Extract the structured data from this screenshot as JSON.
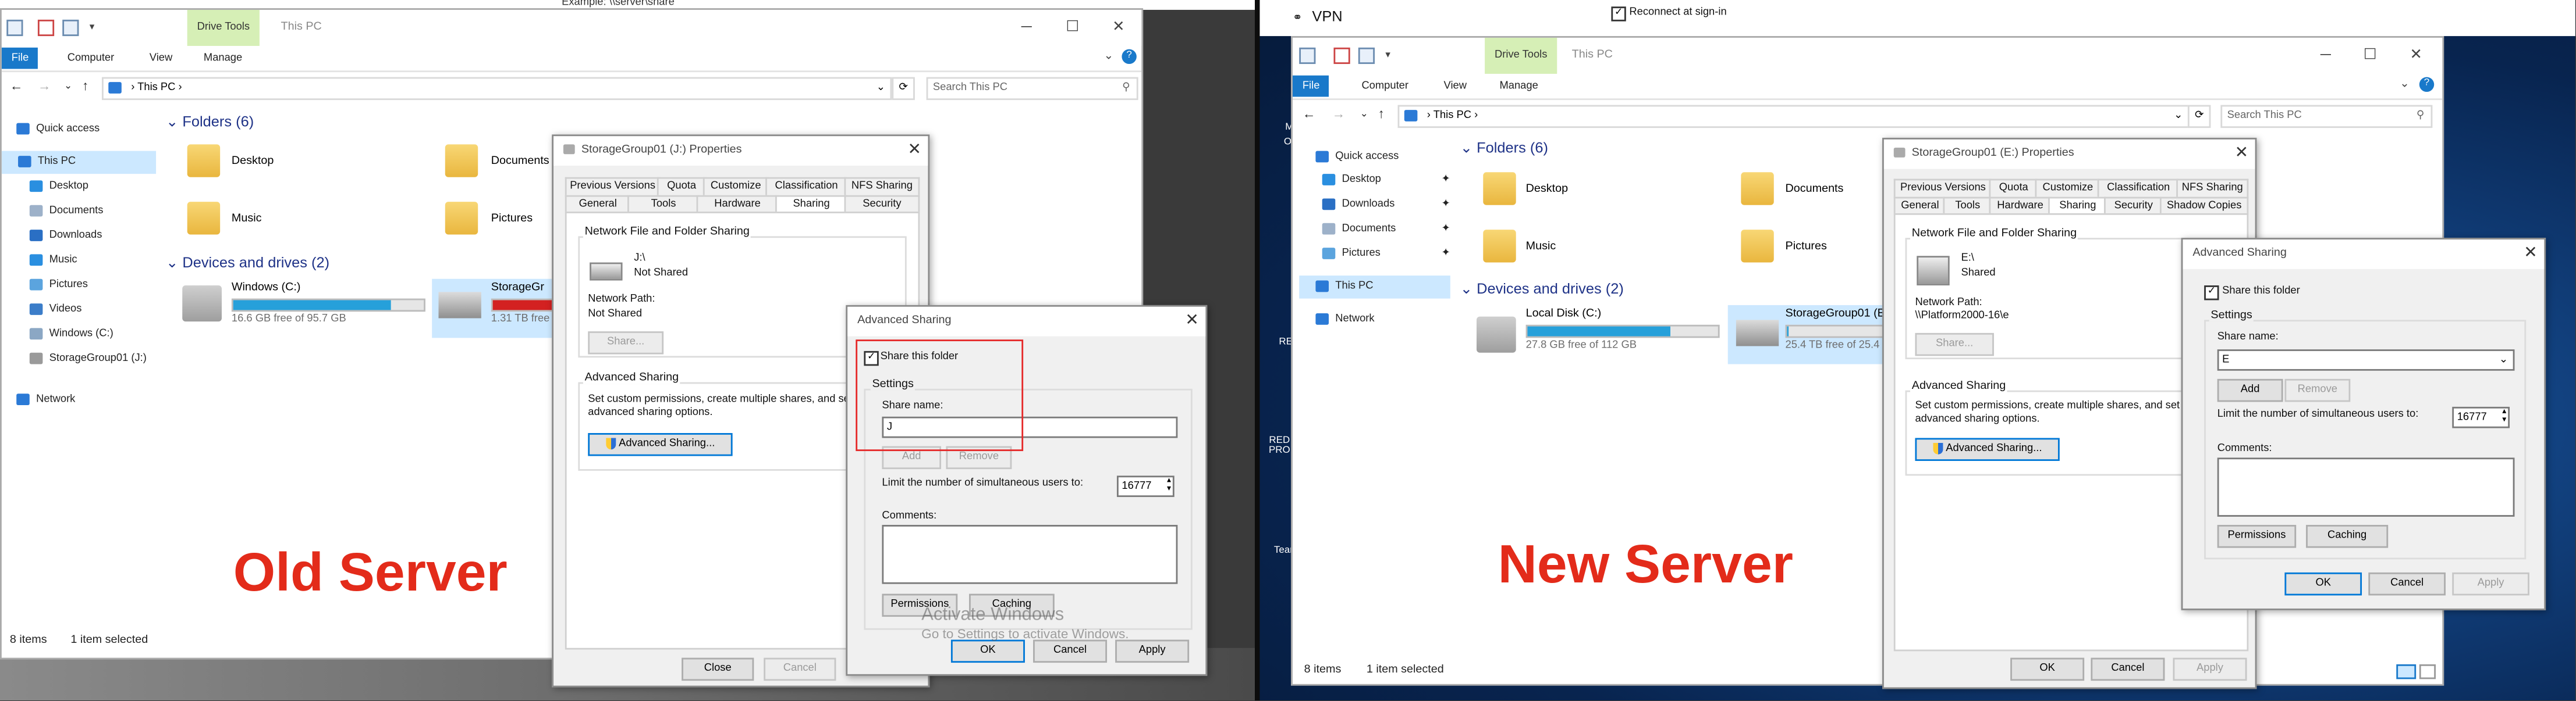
{
  "labels": {
    "left": "Old Server",
    "right": "New Server"
  },
  "watermark": {
    "line1": "Activate Windows",
    "line2": "Go to Settings to activate Windows."
  },
  "left": {
    "top_hint": "Example: \\\\server\\share",
    "ribbon": {
      "context_tab": "Drive Tools",
      "title": "This PC",
      "tabs": [
        "File",
        "Computer",
        "View",
        "Manage"
      ]
    },
    "address": {
      "path": "This PC",
      "search_placeholder": "Search This PC"
    },
    "nav": {
      "quick_access": "Quick access",
      "this_pc": "This PC",
      "items": [
        "Desktop",
        "Documents",
        "Downloads",
        "Music",
        "Pictures",
        "Videos",
        "Windows (C:)",
        "StorageGroup01 (J:)"
      ],
      "network": "Network"
    },
    "folders": {
      "header": "Folders (6)",
      "items": [
        "Desktop",
        "Documents",
        "Music",
        "Pictures"
      ]
    },
    "drives": {
      "header": "Devices and drives (2)",
      "items": [
        {
          "name": "Windows (C:)",
          "free": "16.6 GB free of 95.7 GB",
          "used_fraction": 0.83
        },
        {
          "name": "StorageGr",
          "free": "1.31 TB free",
          "used_fraction": 0.9
        }
      ]
    },
    "status": {
      "count": "8 items",
      "selected": "1 item selected"
    },
    "props": {
      "title": "StorageGroup01 (J:) Properties",
      "tabs_top": [
        "Previous Versions",
        "Quota",
        "Customize",
        "Classification",
        "NFS Sharing"
      ],
      "tabs_bottom": [
        "General",
        "Tools",
        "Hardware",
        "Sharing",
        "Security"
      ],
      "nfs_group": "Network File and Folder Sharing",
      "drive_path": "J:\\",
      "drive_state": "Not Shared",
      "network_path_label": "Network Path:",
      "network_path": "Not Shared",
      "share_btn": "Share...",
      "adv_group": "Advanced Sharing",
      "adv_desc": "Set custom permissions, create multiple shares, and set advanced sharing options.",
      "adv_btn": "Advanced Sharing...",
      "close": "Close",
      "cancel": "Cancel"
    },
    "adv": {
      "title": "Advanced Sharing",
      "share_check": "Share this folder",
      "settings": "Settings",
      "share_name_label": "Share name:",
      "share_name": "J",
      "add": "Add",
      "remove": "Remove",
      "limit_label": "Limit the number of simultaneous users to:",
      "limit": "16777",
      "comments": "Comments:",
      "permissions": "Permissions",
      "caching": "Caching",
      "ok": "OK",
      "cancel": "Cancel",
      "apply": "Apply"
    }
  },
  "right": {
    "vpn": "VPN",
    "reconnect": "Reconnect at sign-in",
    "desktop_icons": [
      "M",
      "Or",
      "RED",
      "RED PRO",
      "Team"
    ],
    "ribbon": {
      "context_tab": "Drive Tools",
      "title": "This PC",
      "tabs": [
        "File",
        "Computer",
        "View",
        "Manage"
      ]
    },
    "address": {
      "path": "This PC",
      "search_placeholder": "Search This PC"
    },
    "nav": {
      "quick_access": "Quick access",
      "items": [
        "Desktop",
        "Downloads",
        "Documents",
        "Pictures"
      ],
      "this_pc": "This PC",
      "network": "Network"
    },
    "folders": {
      "header": "Folders (6)",
      "items": [
        "Desktop",
        "Documents",
        "Music",
        "Pictures"
      ]
    },
    "drives": {
      "header": "Devices and drives (2)",
      "items": [
        {
          "name": "Local Disk (C:)",
          "free": "27.8 GB free of 112 GB",
          "used_fraction": 0.75
        },
        {
          "name": "StorageGroup01 (E",
          "free": "25.4 TB free of 25.4",
          "used_fraction": 0.02
        }
      ]
    },
    "status": {
      "count": "8 items",
      "selected": "1 item selected"
    },
    "props": {
      "title": "StorageGroup01 (E:) Properties",
      "tabs_top": [
        "Previous Versions",
        "Quota",
        "Customize",
        "Classification",
        "NFS Sharing"
      ],
      "tabs_bottom": [
        "General",
        "Tools",
        "Hardware",
        "Sharing",
        "Security",
        "Shadow Copies"
      ],
      "nfs_group": "Network File and Folder Sharing",
      "drive_path": "E:\\",
      "drive_state": "Shared",
      "network_path_label": "Network Path:",
      "network_path": "\\\\Platform2000-16\\e",
      "share_btn": "Share...",
      "adv_group": "Advanced Sharing",
      "adv_desc": "Set custom permissions, create multiple shares, and set advanced sharing options.",
      "adv_btn": "Advanced Sharing...",
      "ok": "OK",
      "cancel": "Cancel",
      "apply": "Apply"
    },
    "adv": {
      "title": "Advanced Sharing",
      "share_check": "Share this folder",
      "settings": "Settings",
      "share_name_label": "Share name:",
      "share_name": "E",
      "add": "Add",
      "remove": "Remove",
      "limit_label": "Limit the number of simultaneous users to:",
      "limit": "16777",
      "comments": "Comments:",
      "permissions": "Permissions",
      "caching": "Caching",
      "ok": "OK",
      "cancel": "Cancel",
      "apply": "Apply"
    }
  }
}
